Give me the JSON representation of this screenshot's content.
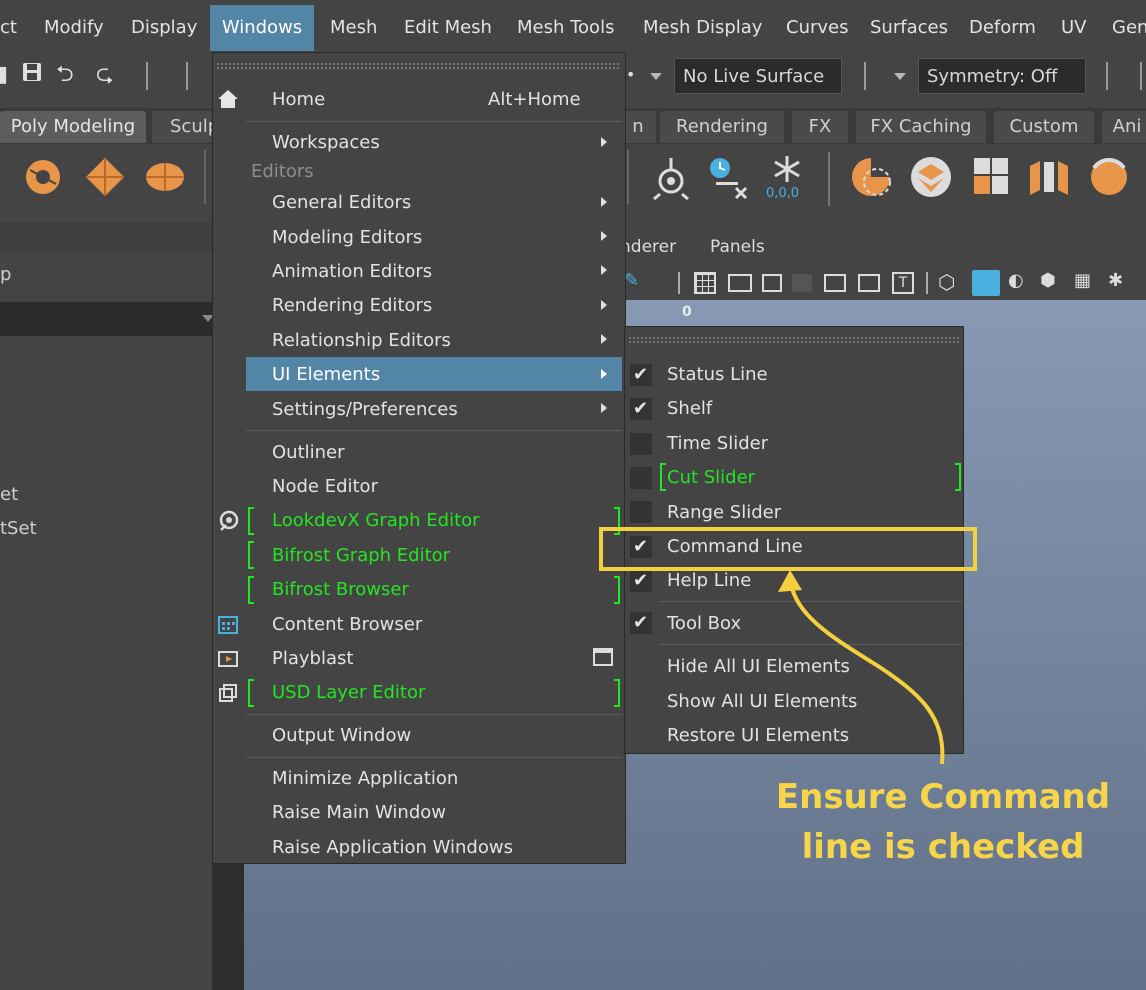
{
  "menubar": {
    "items": [
      "ct",
      "Modify",
      "Display",
      "Windows",
      "Mesh",
      "Edit Mesh",
      "Mesh Tools",
      "Mesh Display",
      "Curves",
      "Surfaces",
      "Deform",
      "UV",
      "Gen"
    ],
    "active": "Windows"
  },
  "statusline": {
    "live_surface": "No Live Surface",
    "symmetry": "Symmetry: Off"
  },
  "shelf_tabs": {
    "left": [
      "Poly Modeling",
      "Sculp"
    ],
    "right": [
      "n",
      "Rendering",
      "FX",
      "FX Caching",
      "Custom",
      "Ani"
    ],
    "active": "Poly Modeling"
  },
  "shelf_icons": [
    "torus-icon",
    "diamond-icon",
    "sphere-icon",
    "aim-icon",
    "clock-delete-icon",
    "freeze-icon",
    "snowflake-icon",
    "pie-select-icon",
    "layers-icon",
    "blocks-icon",
    "split-cube-icon",
    "pot-icon"
  ],
  "freeze_label": "0,0,0",
  "viewport": {
    "menu": [
      "nderer",
      "Panels"
    ],
    "frame_label": "0"
  },
  "left_panel": {
    "field": "p",
    "items": [
      "et",
      "tSet"
    ]
  },
  "windows_menu": {
    "home": "Home",
    "home_shortcut": "Alt+Home",
    "workspaces": "Workspaces",
    "editors_header": "Editors",
    "general_editors": "General Editors",
    "modeling_editors": "Modeling Editors",
    "animation_editors": "Animation Editors",
    "rendering_editors": "Rendering Editors",
    "relationship_editors": "Relationship Editors",
    "ui_elements": "UI Elements",
    "settings_preferences": "Settings/Preferences",
    "outliner": "Outliner",
    "node_editor": "Node Editor",
    "lookdevx": "LookdevX Graph Editor",
    "bifrost_graph": "Bifrost Graph Editor",
    "bifrost_browser": "Bifrost Browser",
    "content_browser": "Content Browser",
    "playblast": "Playblast",
    "usd_layer_editor": "USD Layer Editor",
    "output_window": "Output Window",
    "minimize_application": "Minimize Application",
    "raise_main_window": "Raise Main Window",
    "raise_application_windows": "Raise Application Windows"
  },
  "ui_elements_submenu": {
    "status_line": "Status Line",
    "shelf": "Shelf",
    "time_slider": "Time Slider",
    "cut_slider": "Cut Slider",
    "range_slider": "Range Slider",
    "command_line": "Command Line",
    "help_line": "Help Line",
    "tool_box": "Tool Box",
    "hide_all": "Hide All UI Elements",
    "show_all": "Show All UI Elements",
    "restore": "Restore UI Elements",
    "checked": {
      "status_line": true,
      "shelf": true,
      "time_slider": false,
      "cut_slider": false,
      "range_slider": false,
      "command_line": true,
      "help_line": true,
      "tool_box": true
    }
  },
  "annotation": {
    "line1": "Ensure Command",
    "line2": "line is checked"
  },
  "colors": {
    "menu_highlight": "#5285a6",
    "plugin_green": "#22e622",
    "annotation_yellow": "#f6d54a"
  }
}
